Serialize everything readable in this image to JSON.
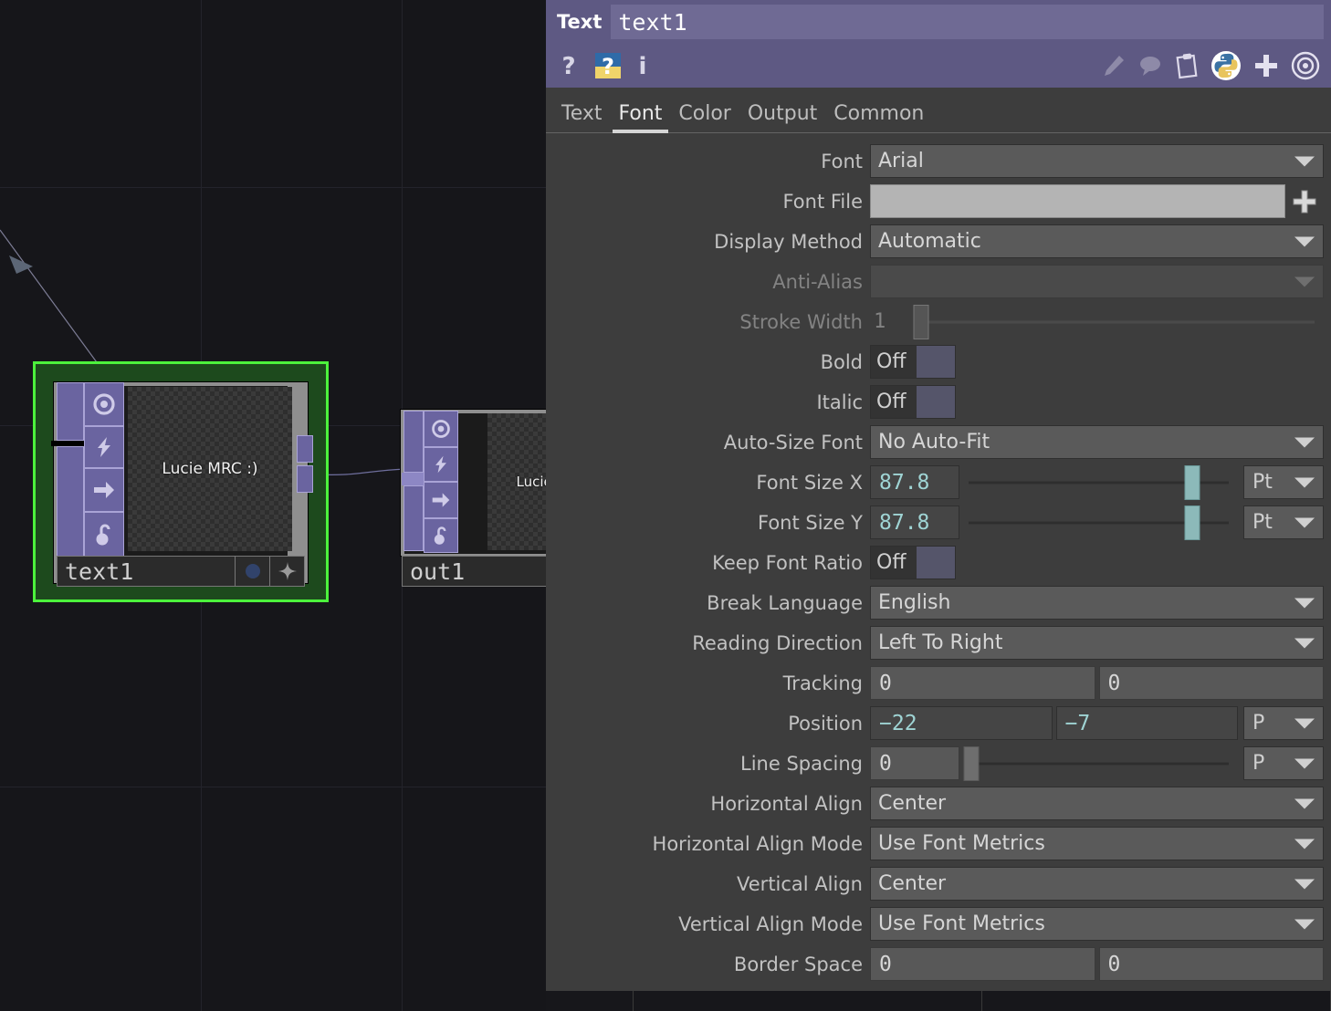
{
  "nodegraph": {
    "nodes": [
      {
        "name": "text1",
        "preview_text": "Lucie MRC :)",
        "selected": true,
        "icons": [
          "viewer-target-icon",
          "render-lightning-icon",
          "preview-arrow-icon",
          "unlock-icon"
        ],
        "footer_icons": [
          "blue-dot-icon",
          "sparkle-icon"
        ]
      },
      {
        "name": "out1",
        "preview_text": "Lucie M",
        "selected": false,
        "icons": [
          "viewer-target-icon",
          "render-lightning-icon",
          "preview-arrow-icon",
          "unlock-icon"
        ],
        "footer_icons": []
      }
    ],
    "selection_color": "#4cf23c"
  },
  "panel": {
    "title": "Text",
    "node_name": "text1",
    "toolbar_left": [
      "help-question-icon",
      "manual-book-icon",
      "info-icon"
    ],
    "toolbar_right": [
      "pencil-icon",
      "comment-bubble-icon",
      "clipboard-icon",
      "python-icon",
      "plus-icon",
      "center-target-icon"
    ],
    "tabs": [
      {
        "label": "Text",
        "active": false
      },
      {
        "label": "Font",
        "active": true
      },
      {
        "label": "Color",
        "active": false
      },
      {
        "label": "Output",
        "active": false
      },
      {
        "label": "Common",
        "active": false
      }
    ],
    "accent_color": "#5e5983",
    "modified_value_color": "#9fd4d4",
    "params": [
      {
        "id": "font",
        "label": "Font",
        "type": "combo",
        "value": "Arial",
        "disabled": false
      },
      {
        "id": "font-file",
        "label": "Font File",
        "type": "file",
        "value": "",
        "disabled": false
      },
      {
        "id": "display-method",
        "label": "Display Method",
        "type": "combo",
        "value": "Automatic",
        "disabled": false
      },
      {
        "id": "anti-alias",
        "label": "Anti-Alias",
        "type": "combo",
        "value": "",
        "disabled": true
      },
      {
        "id": "stroke-width",
        "label": "Stroke Width",
        "type": "slider",
        "value": "1",
        "disabled": true,
        "handle_pct": 1
      },
      {
        "id": "bold",
        "label": "Bold",
        "type": "toggle",
        "value": "Off",
        "disabled": false
      },
      {
        "id": "italic",
        "label": "Italic",
        "type": "toggle",
        "value": "Off",
        "disabled": false
      },
      {
        "id": "auto-size-font",
        "label": "Auto-Size Font",
        "type": "combo",
        "value": "No Auto-Fit",
        "disabled": false
      },
      {
        "id": "font-size-x",
        "label": "Font Size X",
        "type": "slider-unit",
        "value": "87.8",
        "modified": true,
        "unit": "Pt",
        "handle_pct": 86
      },
      {
        "id": "font-size-y",
        "label": "Font Size Y",
        "type": "slider-unit",
        "value": "87.8",
        "modified": true,
        "unit": "Pt",
        "handle_pct": 86
      },
      {
        "id": "keep-font-ratio",
        "label": "Keep Font Ratio",
        "type": "toggle",
        "value": "Off",
        "disabled": false
      },
      {
        "id": "break-language",
        "label": "Break Language",
        "type": "combo",
        "value": "English",
        "disabled": false
      },
      {
        "id": "reading-direction",
        "label": "Reading Direction",
        "type": "combo",
        "value": "Left To Right",
        "disabled": false
      },
      {
        "id": "tracking",
        "label": "Tracking",
        "type": "dual",
        "value_x": "0",
        "value_y": "0",
        "modified": false
      },
      {
        "id": "position",
        "label": "Position",
        "type": "dual-unit",
        "value_x": "−22",
        "value_y": "−7",
        "modified": true,
        "unit": "P"
      },
      {
        "id": "line-spacing",
        "label": "Line Spacing",
        "type": "slider-unit-small",
        "value": "0",
        "modified": false,
        "unit": "P",
        "handle_pct": 1
      },
      {
        "id": "horizontal-align",
        "label": "Horizontal Align",
        "type": "combo",
        "value": "Center",
        "disabled": false
      },
      {
        "id": "horizontal-align-mode",
        "label": "Horizontal Align Mode",
        "type": "combo",
        "value": "Use Font Metrics",
        "disabled": false
      },
      {
        "id": "vertical-align",
        "label": "Vertical Align",
        "type": "combo",
        "value": "Center",
        "disabled": false
      },
      {
        "id": "vertical-align-mode",
        "label": "Vertical Align Mode",
        "type": "combo",
        "value": "Use Font Metrics",
        "disabled": false
      },
      {
        "id": "border-space",
        "label": "Border Space",
        "type": "dual",
        "value_x": "0",
        "value_y": "0",
        "modified": false
      }
    ]
  }
}
